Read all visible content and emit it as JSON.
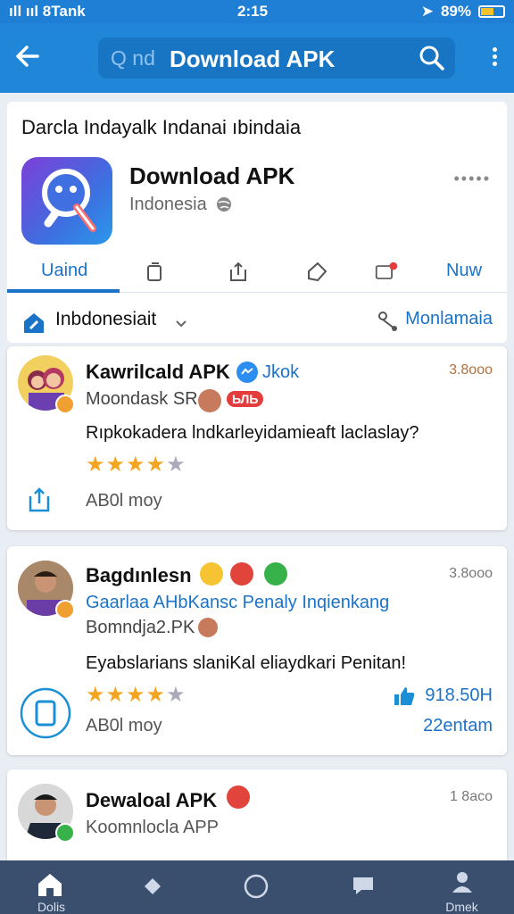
{
  "status_bar": {
    "signal_text": "ıll ııl 8Tank",
    "time": "2:15",
    "battery": "89%"
  },
  "app_bar": {
    "search_prefix": "Q nd",
    "search_query": "Download APK"
  },
  "header": {
    "breadcrumb": "Darcla Indayalk Indanai ıbindaia",
    "app_title": "Download APK",
    "app_subtitle": "Indonesia",
    "more": "•••••",
    "tabs": [
      "Uaind",
      "Nuw"
    ],
    "location": "Inbdonesiait",
    "right_link": "Monlamaia"
  },
  "cards": [
    {
      "title": "Kawrilcald APK",
      "title_suffix": "Jkok",
      "count": "3.8ooo",
      "sub": "Moondask SR",
      "badge": "ЬЛЬ",
      "body": "Rıpkokadera lndkarleyidamieaft laclaslay?",
      "rating": 4,
      "time": "AB0l moy"
    },
    {
      "title": "Bagdınlesn",
      "count": "3.8ooo",
      "sub_blue": "Gaarlaa AHbKansc Penaly Inqienkang",
      "sub": "Bomndja2.PK",
      "body": "Eyabslarians slaniKal eliaydkari Penitan!",
      "rating": 4,
      "time": "AB0l moy",
      "likes": "918.50H",
      "likes_time": "22entam"
    },
    {
      "title": "Dewaloal APK",
      "count": "1 8aco",
      "sub": "Koomnlocla APP"
    }
  ],
  "bottom_nav": {
    "items": [
      "Dolis",
      "",
      "",
      "",
      "Dmek"
    ]
  },
  "colors": {
    "primary": "#1f86d8",
    "accent_text": "#1b73c8",
    "star": "#f3a521",
    "nav_bg": "#3a4f6e"
  }
}
